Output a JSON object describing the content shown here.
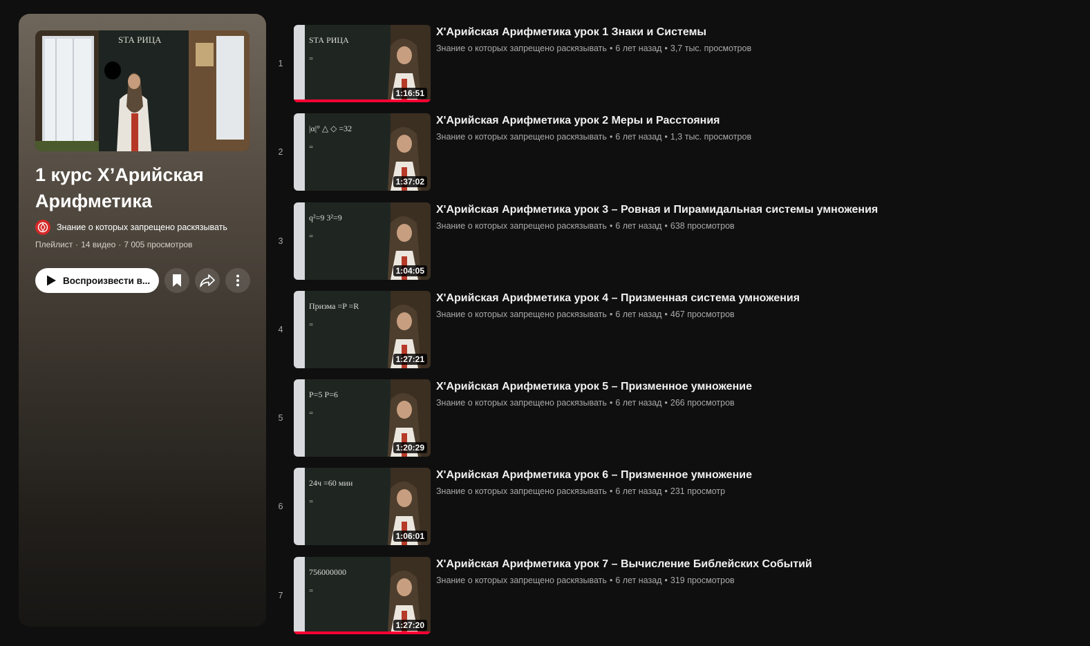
{
  "playlist": {
    "title": "1 курс Х’Арийская Арифметика",
    "channel": "Знание о которых запрещено раскязывать",
    "type_label": "Плейлист",
    "video_count": "14 видео",
    "views": "7 005 просмотров",
    "play_label": "Воспроизвести в...",
    "thumb_board_text": "ЅТА РИЦА"
  },
  "icons": {
    "play": "play-icon",
    "save": "bookmark-icon",
    "share": "share-icon",
    "more": "more-vert-icon",
    "channel": "channel-logo-icon"
  },
  "colors": {
    "accent": "#ff0033",
    "background": "#0f0f0f",
    "meta_text": "#aaaaaa"
  },
  "videos": [
    {
      "index": "1",
      "title": "Х'Арийская Арифметика урок 1 Знаки и Системы",
      "channel": "Знание о которых запрещено раскязывать",
      "age": "6 лет назад",
      "views": "3,7 тыс. просмотров",
      "duration": "1:16:51",
      "watched": 1.0,
      "board": "ЅТА РИЦА"
    },
    {
      "index": "2",
      "title": "Х'Арийская Арифметика урок 2 Меры и Расстояния",
      "channel": "Знание о которых запрещено раскязывать",
      "age": "6 лет назад",
      "views": "1,3 тыс. просмотров",
      "duration": "1:37:02",
      "watched": 0,
      "board": "|α|° △ ◇ =32"
    },
    {
      "index": "3",
      "title": "Х'Арийская Арифметика урок 3 – Ровная и Пирамидальная системы умножения",
      "channel": "Знание о которых запрещено раскязывать",
      "age": "6 лет назад",
      "views": "638 просмотров",
      "duration": "1:04:05",
      "watched": 0,
      "board": "q²=9 3²=9"
    },
    {
      "index": "4",
      "title": "Х'Арийская Арифметика урок 4 – Призменная система умножения",
      "channel": "Знание о которых запрещено раскязывать",
      "age": "6 лет назад",
      "views": "467 просмотров",
      "duration": "1:27:21",
      "watched": 0,
      "board": "Призма =P =R"
    },
    {
      "index": "5",
      "title": "Х'Арийская Арифметика урок 5 – Призменное умножение",
      "channel": "Знание о которых запрещено раскязывать",
      "age": "6 лет назад",
      "views": "266 просмотров",
      "duration": "1:20:29",
      "watched": 0,
      "board": "P=5 P=6"
    },
    {
      "index": "6",
      "title": "Х'Арийская Арифметика урок 6 – Призменное умножение",
      "channel": "Знание о которых запрещено раскязывать",
      "age": "6 лет назад",
      "views": "231 просмотр",
      "duration": "1:06:01",
      "watched": 0,
      "board": "24ч =60 мин"
    },
    {
      "index": "7",
      "title": "Х'Арийская Арифметика урок 7 – Вычисление Библейских Событий",
      "channel": "Знание о которых запрещено раскязывать",
      "age": "6 лет назад",
      "views": "319 просмотров",
      "duration": "1:27:20",
      "watched": 1.0,
      "board": "756000000"
    }
  ]
}
